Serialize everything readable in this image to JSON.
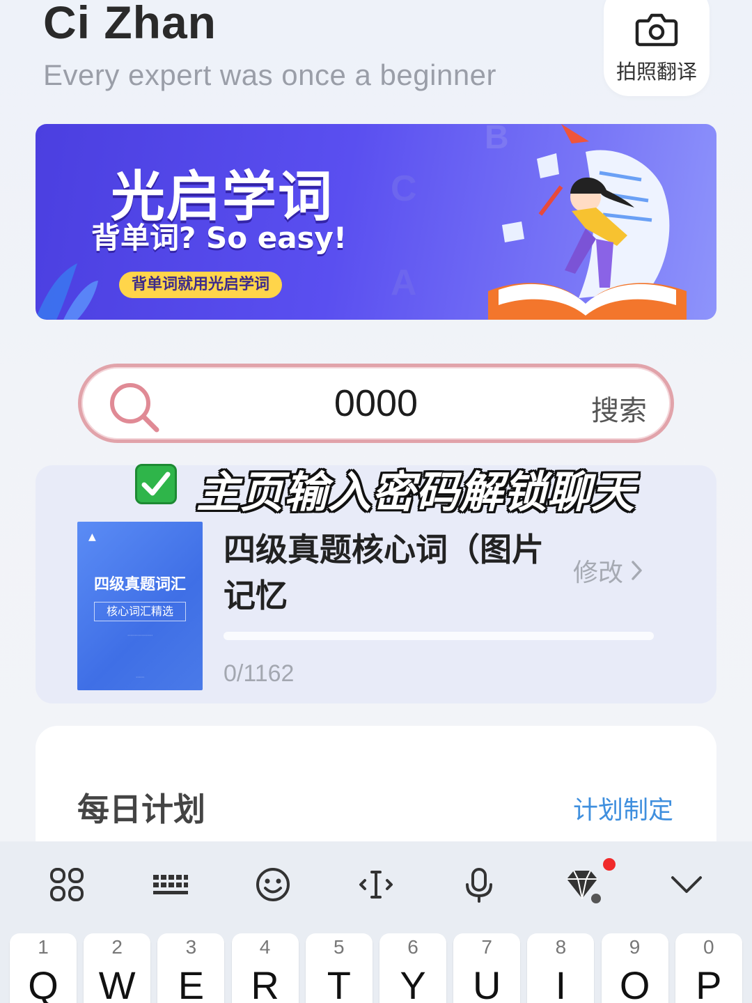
{
  "header": {
    "title": "Ci Zhan",
    "subtitle": "Every expert was once a beginner",
    "photo_translate_label": "拍照翻译",
    "photo_translate_icon": "camera-icon"
  },
  "banner": {
    "title": "光启学词",
    "subtitle": "背单词? So easy!",
    "pill": "背单词就用光启学词"
  },
  "search": {
    "value": "0000",
    "button_label": "搜索",
    "icon": "search-icon"
  },
  "overlay": {
    "caption": "主页输入密码解锁聊天",
    "icon": "check-mark-icon",
    "icon_color": "#2fb54a"
  },
  "word_book": {
    "cover": {
      "title": "四级真题词汇",
      "subtitle": "核心词汇精选"
    },
    "title": "四级真题核心词（图片记忆",
    "edit_label": "修改",
    "progress_text": "0/1162",
    "progress_fraction": 0
  },
  "daily_plan": {
    "title": "每日计划",
    "link_label": "计划制定",
    "link_color": "#3f8fde"
  },
  "keyboard": {
    "toolbar_icons": [
      "apps-grid-icon",
      "keyboard-icon",
      "emoji-icon",
      "cursor-move-icon",
      "microphone-icon",
      "diamond-ad-icon",
      "collapse-keyboard-icon"
    ],
    "keys": [
      {
        "num": "1",
        "ch": "Q"
      },
      {
        "num": "2",
        "ch": "W"
      },
      {
        "num": "3",
        "ch": "E"
      },
      {
        "num": "4",
        "ch": "R"
      },
      {
        "num": "5",
        "ch": "T"
      },
      {
        "num": "6",
        "ch": "Y"
      },
      {
        "num": "7",
        "ch": "U"
      },
      {
        "num": "8",
        "ch": "I"
      },
      {
        "num": "9",
        "ch": "O"
      },
      {
        "num": "0",
        "ch": "P"
      }
    ]
  }
}
